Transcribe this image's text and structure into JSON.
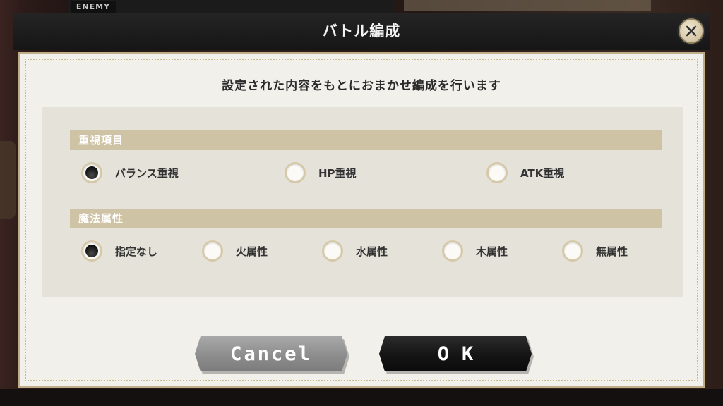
{
  "background": {
    "enemy_tag": "ENEMY"
  },
  "dialog": {
    "title": "バトル編成",
    "close_icon": "close-icon",
    "subtitle": "設定された内容をもとにおまかせ編成を行います",
    "sections": [
      {
        "header": "重視項目",
        "options": [
          {
            "label": "バランス重視",
            "selected": true
          },
          {
            "label": "HP重視",
            "selected": false
          },
          {
            "label": "ATK重視",
            "selected": false
          }
        ]
      },
      {
        "header": "魔法属性",
        "options": [
          {
            "label": "指定なし",
            "selected": true
          },
          {
            "label": "火属性",
            "selected": false
          },
          {
            "label": "水属性",
            "selected": false
          },
          {
            "label": "木属性",
            "selected": false
          },
          {
            "label": "無属性",
            "selected": false
          }
        ]
      }
    ],
    "buttons": {
      "cancel_label": "Cancel",
      "ok_label": "OK"
    }
  },
  "colors": {
    "panel_bg": "#f2f0eb",
    "section_header": "#cfc3a5",
    "accent_gold": "#bfae87"
  }
}
